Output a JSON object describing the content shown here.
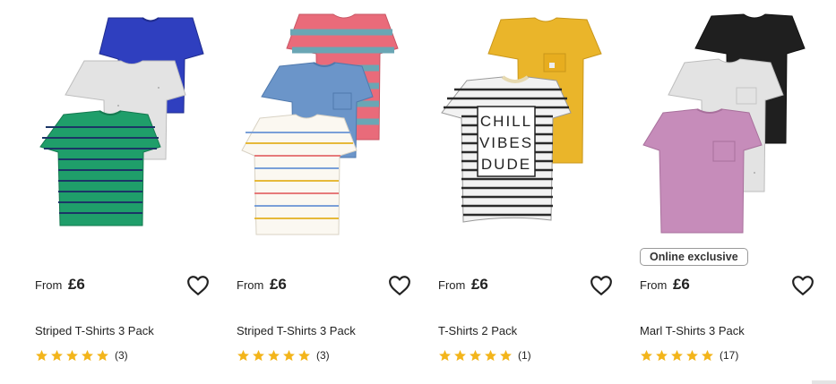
{
  "products": [
    {
      "price_prefix": "From",
      "price": "£6",
      "title": "Striped T-Shirts 3 Pack",
      "rating": 5,
      "review_count": "(3)",
      "badge": "",
      "image_icon": "striped-tshirts-3-pack-image"
    },
    {
      "price_prefix": "From",
      "price": "£6",
      "title": "Striped T-Shirts 3 Pack",
      "rating": 5,
      "review_count": "(3)",
      "badge": "",
      "image_icon": "striped-tshirts-3-pack-image"
    },
    {
      "price_prefix": "From",
      "price": "£6",
      "title": "T-Shirts 2 Pack",
      "rating": 5,
      "review_count": "(1)",
      "badge": "",
      "image_icon": "tshirts-2-pack-image",
      "print_text": [
        "CHILL",
        "VIBES",
        "DUDE"
      ]
    },
    {
      "price_prefix": "From",
      "price": "£6",
      "title": "Marl T-Shirts 3 Pack",
      "rating": 5,
      "review_count": "(17)",
      "badge": "Online exclusive",
      "image_icon": "marl-tshirts-3-pack-image"
    }
  ],
  "colors": {
    "star": "#f3b51b",
    "heart_stroke": "#222222",
    "badge_border": "#9a9a9a",
    "royal_blue": "#2f3fbf",
    "green": "#1f9e6a",
    "navy_stripe": "#1b3566",
    "pink": "#e96b7a",
    "teal_stripe": "#6aa6b4",
    "denim": "#6b95c9",
    "mustard": "#eab52a",
    "charcoal": "#1f1f1f",
    "mauve": "#c68cba",
    "grey_marl": "#e3e3e3",
    "cream": "#fbf8f1"
  }
}
